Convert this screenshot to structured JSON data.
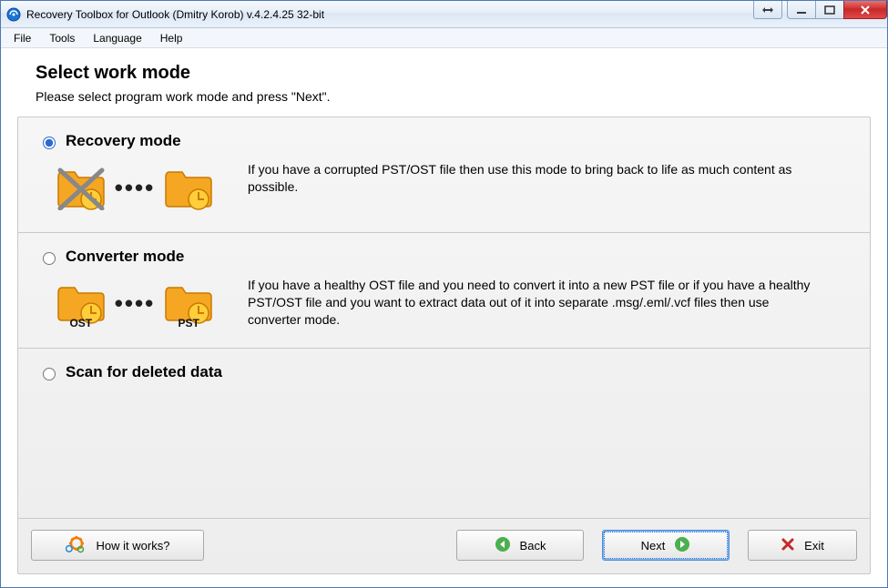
{
  "window": {
    "title": "Recovery Toolbox for Outlook (Dmitry Korob) v.4.2.4.25 32-bit"
  },
  "menu": {
    "file": "File",
    "tools": "Tools",
    "language": "Language",
    "help": "Help"
  },
  "header": {
    "title": "Select work mode",
    "subtitle": "Please select program work mode and press \"Next\"."
  },
  "modes": {
    "recovery": {
      "label": "Recovery mode",
      "desc": "If you have a corrupted PST/OST file then use this mode to bring back to life as much content as possible.",
      "selected": true
    },
    "converter": {
      "label": "Converter mode",
      "desc": "If you have a healthy OST file and you need to convert it into a new PST file or if you have a healthy PST/OST file and you want to extract data out of it into separate .msg/.eml/.vcf files then use converter mode.",
      "selected": false,
      "badge_ost": "OST",
      "badge_pst": "PST"
    },
    "scan": {
      "label": "Scan for deleted data",
      "selected": false
    }
  },
  "buttons": {
    "how": "How it works?",
    "back": "Back",
    "next": "Next",
    "exit": "Exit"
  }
}
